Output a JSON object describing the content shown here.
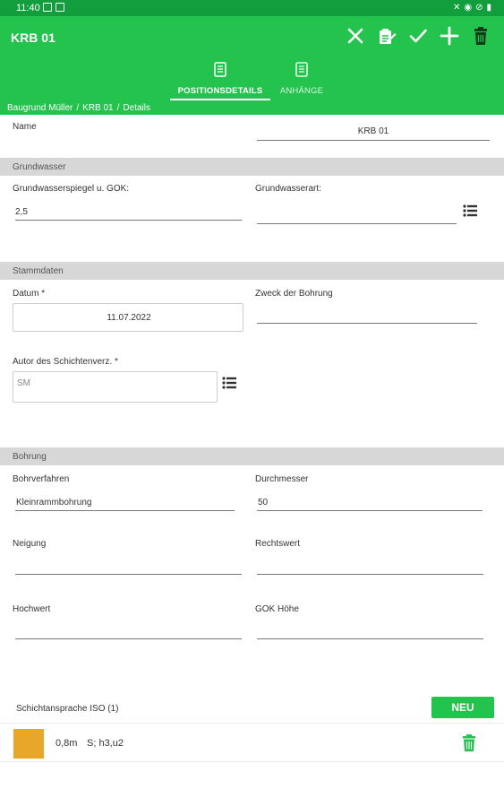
{
  "status_bar": {
    "time": "11:40"
  },
  "app": {
    "title": "KRB 01",
    "actions": [
      "close-icon",
      "clipboard-edit-icon",
      "check-icon",
      "add-icon",
      "trash-icon"
    ]
  },
  "tabs": [
    {
      "label": "POSITIONSDETAILS",
      "icon": "document-icon"
    },
    {
      "label": "ANHÄNGE",
      "icon": "document-icon"
    }
  ],
  "breadcrumb": [
    "Baugrund Müller",
    "KRB 01",
    "Details"
  ],
  "fields": {
    "name": {
      "label": "Name",
      "value": "KRB 01"
    }
  },
  "sections": {
    "grundwasser": {
      "title": "Grundwasser",
      "spiegel_label": "Grundwasserspiegel u. GOK:",
      "spiegel_value": "2,5",
      "art_label": "Grundwasserart:",
      "art_value": ""
    },
    "stammdaten": {
      "title": "Stammdaten",
      "datum_label": "Datum *",
      "datum_value": "11.07.2022",
      "zweck_label": "Zweck der Bohrung",
      "zweck_value": "",
      "autor_label": "Autor des Schichtenverz. *",
      "autor_value": "SM"
    },
    "bohrung": {
      "title": "Bohrung",
      "verfahren_label": "Bohrverfahren",
      "verfahren_value": "Kleinrammbohrung",
      "durchmesser_label": "Durchmesser",
      "durchmesser_value": "50",
      "neigung_label": "Neigung",
      "rechtswert_label": "Rechtswert",
      "hochwert_label": "Hochwert",
      "gok_label": "GOK Höhe"
    }
  },
  "layers": {
    "title": "Schichtansprache ISO (1)",
    "new_button": "NEU",
    "items": [
      {
        "depth": "0,8m",
        "description": "S; h3,u2",
        "color": "#e9a72a"
      }
    ]
  },
  "colors": {
    "primary": "#23c34e",
    "status_bar": "#129e3d",
    "section_bg": "#d7d7d7"
  }
}
